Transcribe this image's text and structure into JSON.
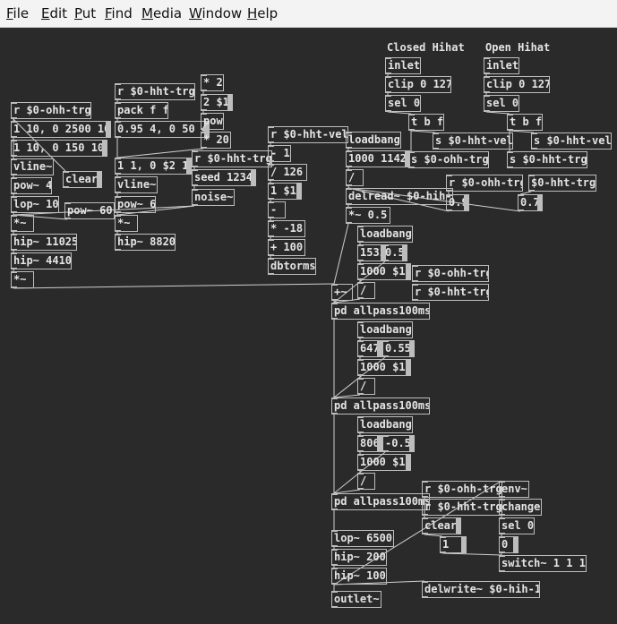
{
  "menu": [
    "File",
    "Edit",
    "Put",
    "Find",
    "Media",
    "Window",
    "Help"
  ],
  "menu_mnemonics": [
    "F",
    "E",
    "P",
    "F",
    "M",
    "W",
    "H"
  ],
  "labels": {
    "closed_hihat": "Closed Hihat",
    "open_hihat": "Open Hihat"
  },
  "boxes": [
    {
      "id": "ohh-inlet",
      "text": "inlet",
      "kind": "obj"
    },
    {
      "id": "ohh-clip",
      "text": "clip 0 127",
      "kind": "obj"
    },
    {
      "id": "ohh-sel",
      "text": "sel 0",
      "kind": "obj"
    },
    {
      "id": "ohh-tbf",
      "text": "t b f",
      "kind": "obj"
    },
    {
      "id": "ohh-s-vel",
      "text": "s $0-hht-vel",
      "kind": "obj"
    },
    {
      "id": "ohh-s-trg",
      "text": "s $0-hht-trg",
      "kind": "obj"
    },
    {
      "id": "chh-inlet",
      "text": "inlet",
      "kind": "obj"
    },
    {
      "id": "chh-clip",
      "text": "clip 0 127",
      "kind": "obj"
    },
    {
      "id": "chh-sel",
      "text": "sel 0",
      "kind": "obj"
    },
    {
      "id": "chh-tbf",
      "text": "t b f",
      "kind": "obj"
    },
    {
      "id": "chh-s-vel",
      "text": "s $0-hht-vel",
      "kind": "obj"
    },
    {
      "id": "chh-s-trg",
      "text": "s $0-ohh-trg",
      "kind": "obj"
    },
    {
      "id": "r-ohh-trg",
      "text": "r $0-ohh-trg",
      "kind": "obj"
    },
    {
      "id": "msg-1-10",
      "text": "1 10, 0 2500 10",
      "kind": "msg"
    },
    {
      "id": "msg-1-10b",
      "text": "1 10, 0 150 10",
      "kind": "msg"
    },
    {
      "id": "vline1",
      "text": "vline~",
      "kind": "obj"
    },
    {
      "id": "pow4",
      "text": "pow~ 4",
      "kind": "obj"
    },
    {
      "id": "lop10",
      "text": "lop~ 10",
      "kind": "obj"
    },
    {
      "id": "mul1",
      "text": "*~",
      "kind": "obj"
    },
    {
      "id": "hip11025",
      "text": "hip~ 11025",
      "kind": "obj"
    },
    {
      "id": "hip4410",
      "text": "hip~ 4410",
      "kind": "obj"
    },
    {
      "id": "mul2",
      "text": "*~",
      "kind": "obj"
    },
    {
      "id": "clear1",
      "text": "clear",
      "kind": "msg"
    },
    {
      "id": "pow60",
      "text": "pow~ 60",
      "kind": "obj"
    },
    {
      "id": "r-hht-trg",
      "text": "r $0-hht-trg",
      "kind": "obj"
    },
    {
      "id": "packff",
      "text": "pack f f",
      "kind": "obj"
    },
    {
      "id": "msg-095",
      "text": "0.95 4, 0 50 4",
      "kind": "msg"
    },
    {
      "id": "msg-11",
      "text": "1 1, 0 $2 1",
      "kind": "msg"
    },
    {
      "id": "vline2",
      "text": "vline~",
      "kind": "obj"
    },
    {
      "id": "pow6",
      "text": "pow~ 6",
      "kind": "obj"
    },
    {
      "id": "mul3",
      "text": "*~",
      "kind": "obj"
    },
    {
      "id": "hip8820",
      "text": "hip~ 8820",
      "kind": "obj"
    },
    {
      "id": "mul-2",
      "text": "* 2",
      "kind": "obj"
    },
    {
      "id": "msg-2s1",
      "text": "2 $1",
      "kind": "msg"
    },
    {
      "id": "pow",
      "text": "pow",
      "kind": "obj"
    },
    {
      "id": "mul20",
      "text": "* 20",
      "kind": "obj"
    },
    {
      "id": "r-hht-trg2",
      "text": "r $0-hht-trg",
      "kind": "obj"
    },
    {
      "id": "seed",
      "text": "seed 1234",
      "kind": "msg"
    },
    {
      "id": "noise",
      "text": "noise~",
      "kind": "obj"
    },
    {
      "id": "r-hht-vel",
      "text": "r $0-hht-vel",
      "kind": "obj"
    },
    {
      "id": "minus1",
      "text": "- 1",
      "kind": "obj"
    },
    {
      "id": "div126",
      "text": "/ 126",
      "kind": "obj"
    },
    {
      "id": "msg-1s1",
      "text": "1 $1",
      "kind": "msg"
    },
    {
      "id": "minus",
      "text": "-",
      "kind": "obj"
    },
    {
      "id": "mul-18",
      "text": "* -18",
      "kind": "obj"
    },
    {
      "id": "plus100",
      "text": "+ 100",
      "kind": "obj"
    },
    {
      "id": "dbtorms",
      "text": "dbtorms",
      "kind": "obj"
    },
    {
      "id": "loadbang1",
      "text": "loadbang",
      "kind": "obj"
    },
    {
      "id": "msg-1000-1142",
      "text": "1000 1142",
      "kind": "msg"
    },
    {
      "id": "slash1",
      "text": "/",
      "kind": "obj"
    },
    {
      "id": "delread",
      "text": "delread~ $0-hih-1",
      "kind": "obj"
    },
    {
      "id": "r-ohh-trg2",
      "text": "r $0-ohh-trg",
      "kind": "obj"
    },
    {
      "id": "r-hht-trg3",
      "text": "$0-hht-trg",
      "kind": "obj"
    },
    {
      "id": "num09",
      "text": "0.9",
      "kind": "msg"
    },
    {
      "id": "num07",
      "text": "0.7",
      "kind": "msg"
    },
    {
      "id": "mul05",
      "text": "*~ 0.5",
      "kind": "obj"
    },
    {
      "id": "loadbang2",
      "text": "loadbang",
      "kind": "obj"
    },
    {
      "id": "n1531",
      "text": "1531",
      "kind": "msg"
    },
    {
      "id": "n05",
      "text": "0.5",
      "kind": "msg"
    },
    {
      "id": "msg-1000s1a",
      "text": "1000 $1",
      "kind": "msg"
    },
    {
      "id": "slash2",
      "text": "/",
      "kind": "obj"
    },
    {
      "id": "r-ohh-trg3",
      "text": "r $0-ohh-trg",
      "kind": "obj"
    },
    {
      "id": "r-hht-trg4",
      "text": "r $0-hht-trg",
      "kind": "obj"
    },
    {
      "id": "plus-tilde",
      "text": "+~",
      "kind": "obj"
    },
    {
      "id": "allpass1",
      "text": "pd allpass100ms",
      "kind": "obj"
    },
    {
      "id": "loadbang3",
      "text": "loadbang",
      "kind": "obj"
    },
    {
      "id": "n647",
      "text": "647",
      "kind": "msg"
    },
    {
      "id": "n055",
      "text": "0.55",
      "kind": "msg"
    },
    {
      "id": "msg-1000s1b",
      "text": "1000 $1",
      "kind": "msg"
    },
    {
      "id": "slash3",
      "text": "/",
      "kind": "obj"
    },
    {
      "id": "allpass2",
      "text": "pd allpass100ms",
      "kind": "obj"
    },
    {
      "id": "loadbang4",
      "text": "loadbang",
      "kind": "obj"
    },
    {
      "id": "n806",
      "text": "806",
      "kind": "msg"
    },
    {
      "id": "nm05",
      "text": "-0.5",
      "kind": "msg"
    },
    {
      "id": "msg-1000s1c",
      "text": "1000 $1",
      "kind": "msg"
    },
    {
      "id": "slash4",
      "text": "/",
      "kind": "obj"
    },
    {
      "id": "allpass3",
      "text": "pd allpass100ms",
      "kind": "obj"
    },
    {
      "id": "r-ohh-trg4",
      "text": "r $0-ohh-trg",
      "kind": "obj"
    },
    {
      "id": "r-hht-trg5",
      "text": "r $0-hht-trg",
      "kind": "obj"
    },
    {
      "id": "clear2",
      "text": "clear",
      "kind": "msg"
    },
    {
      "id": "num1",
      "text": "1",
      "kind": "msg"
    },
    {
      "id": "env",
      "text": "env~",
      "kind": "obj"
    },
    {
      "id": "change",
      "text": "change",
      "kind": "obj"
    },
    {
      "id": "sel0c",
      "text": "sel 0",
      "kind": "obj"
    },
    {
      "id": "num0",
      "text": "0",
      "kind": "msg"
    },
    {
      "id": "switch",
      "text": "switch~ 1 1 1",
      "kind": "obj"
    },
    {
      "id": "lop6500",
      "text": "lop~ 6500",
      "kind": "obj"
    },
    {
      "id": "hip200",
      "text": "hip~ 200",
      "kind": "obj"
    },
    {
      "id": "hip100",
      "text": "hip~ 100",
      "kind": "obj"
    },
    {
      "id": "outlet",
      "text": "outlet~",
      "kind": "obj"
    },
    {
      "id": "delwrite",
      "text": "delwrite~ $0-hih-1",
      "kind": "obj"
    }
  ],
  "colors": {
    "background": "#2a2a2a",
    "box_border": "#bdbdbd",
    "text": "#e4e4e4",
    "menubar": "#f3f3f3"
  }
}
